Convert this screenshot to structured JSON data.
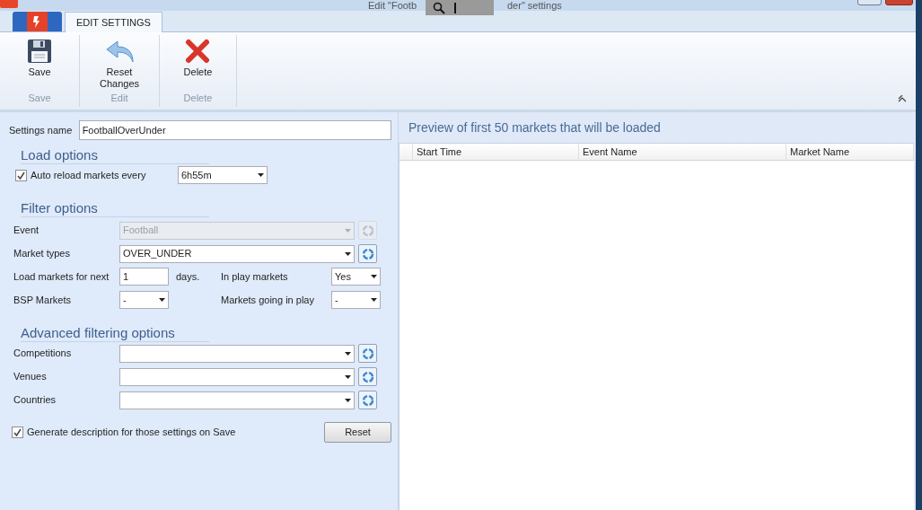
{
  "window": {
    "title_start": "Edit \"Footb",
    "title_end": "der\" settings"
  },
  "tabs": [
    {
      "label": "EDIT SETTINGS",
      "selected": true
    }
  ],
  "ribbon": {
    "groups": [
      {
        "name": "Save",
        "buttons": [
          {
            "kind": "save",
            "label": "Save"
          }
        ]
      },
      {
        "name": "Edit",
        "buttons": [
          {
            "kind": "undo",
            "label": "Reset\nChanges"
          }
        ]
      },
      {
        "name": "Delete",
        "buttons": [
          {
            "kind": "delete",
            "label": "Delete"
          }
        ]
      }
    ]
  },
  "settings_name": {
    "label": "Settings name",
    "value": "FootballOverUnder"
  },
  "load_options": {
    "heading": "Load options",
    "auto_reload": {
      "label": "Auto reload markets every",
      "checked": true,
      "value": "6h55m"
    }
  },
  "filter_options": {
    "heading": "Filter options",
    "event": {
      "label": "Event",
      "value": "Football",
      "disabled": true
    },
    "market_types": {
      "label": "Market types",
      "value": "OVER_UNDER",
      "disabled": false
    },
    "load_next": {
      "label": "Load markets for next",
      "value": "1",
      "unit": "days."
    },
    "in_play": {
      "label": "In play markets",
      "value": "Yes"
    },
    "bsp": {
      "label": "BSP Markets",
      "value": "-"
    },
    "going_in_play": {
      "label": "Markets going in play",
      "value": "-"
    }
  },
  "advanced": {
    "heading": "Advanced filtering options",
    "fields": [
      {
        "label": "Competitions"
      },
      {
        "label": "Venues"
      },
      {
        "label": "Countries"
      }
    ]
  },
  "generate_description": {
    "label": "Generate description for those settings on Save",
    "checked": true
  },
  "reset_button": "Reset",
  "preview": {
    "title": "Preview of first 50 markets that will be loaded",
    "columns": [
      "Start Time",
      "Event Name",
      "Market Name"
    ]
  }
}
